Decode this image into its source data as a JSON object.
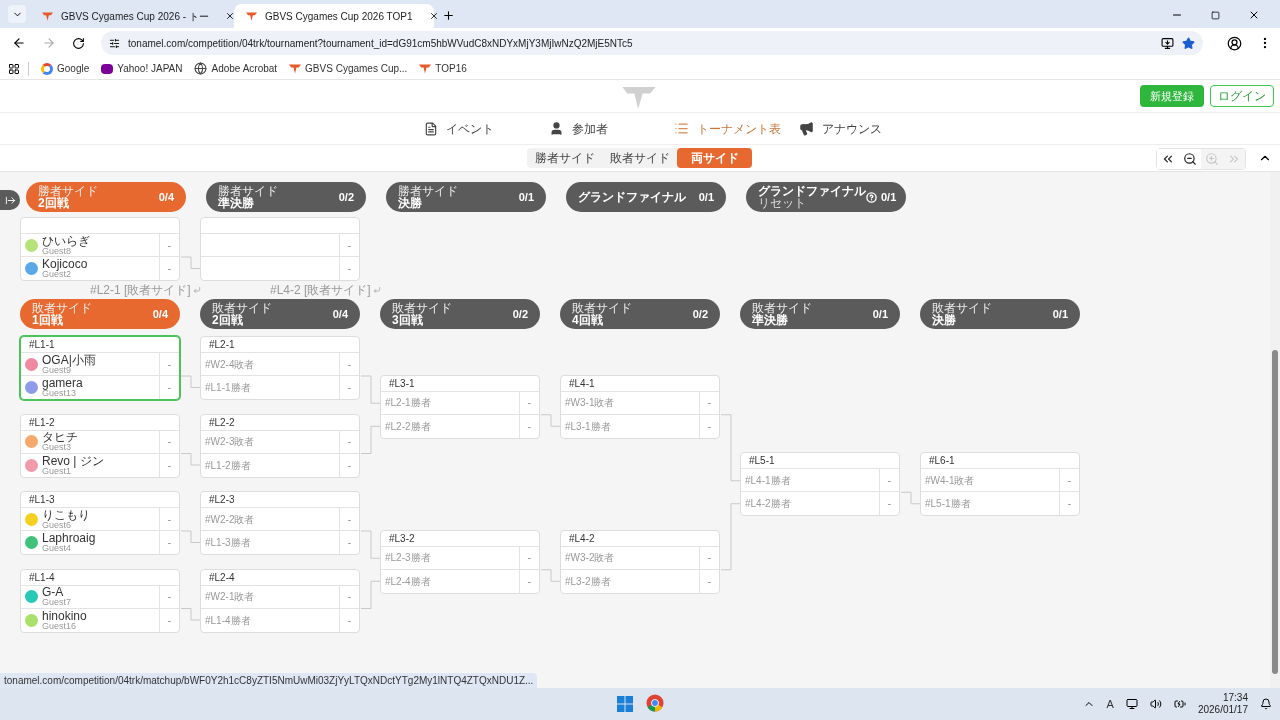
{
  "browser": {
    "tabs": [
      {
        "title": "GBVS Cygames Cup 2026 - トー",
        "selected": false
      },
      {
        "title": "GBVS Cygames Cup 2026 TOP1",
        "selected": true
      }
    ],
    "url": "tonamel.com/competition/04trk/tournament?tournament_id=dG91cm5hbWVudC8xNDYxMjY3MjIwNzQ2MjE5NTc5",
    "bookmarks": [
      {
        "kind": "google",
        "label": "Google"
      },
      {
        "kind": "yahoo",
        "label": "Yahoo! JAPAN"
      },
      {
        "kind": "globe",
        "label": "Adobe Acrobat"
      },
      {
        "kind": "site",
        "label": "GBVS Cygames Cup..."
      },
      {
        "kind": "site",
        "label": "TOP16"
      }
    ]
  },
  "header": {
    "buttons": [
      {
        "kind": "primary",
        "label": "新規登録"
      },
      {
        "kind": "outline",
        "label": "ログイン"
      }
    ]
  },
  "nav": [
    {
      "kind": "event",
      "label": "イベント",
      "selected": false
    },
    {
      "kind": "people",
      "label": "参加者",
      "selected": false
    },
    {
      "kind": "bracket",
      "label": "トーナメント表",
      "selected": true
    },
    {
      "kind": "announce",
      "label": "アナウンス",
      "selected": false
    }
  ],
  "view_tabs": [
    {
      "label": "勝者サイド",
      "selected": false
    },
    {
      "label": "敗者サイド",
      "selected": false
    },
    {
      "label": "両サイド",
      "selected": true
    }
  ],
  "zoom_controls": [
    {
      "kind": "first",
      "disabled": false
    },
    {
      "kind": "zoom_out",
      "disabled": false
    },
    {
      "kind": "zoom_in",
      "disabled": true
    },
    {
      "kind": "last",
      "disabled": true
    }
  ],
  "winners": [
    {
      "side": "勝者サイド",
      "name": "2回戦",
      "progress": "0/4",
      "active": true,
      "matches": [
        {
          "highlighted": false,
          "note": "#L2-1 [敗者サイド]",
          "slots": [
            {
              "kind": "player",
              "name": "ひいらぎ",
              "guest": "Guest8",
              "color": "#b5e37a",
              "score": "-"
            },
            {
              "kind": "player",
              "name": "Kojicoco",
              "guest": "Guest2",
              "color": "#5aa8e8",
              "score": "-"
            }
          ]
        }
      ]
    },
    {
      "side": "勝者サイド",
      "name": "準決勝",
      "progress": "0/2",
      "active": false,
      "matches": [
        {
          "highlighted": false,
          "note": "#L4-2 [敗者サイド]",
          "slots": [
            {
              "kind": "placeholder",
              "score": "-"
            },
            {
              "kind": "placeholder",
              "score": "-"
            }
          ]
        }
      ]
    },
    {
      "side": "勝者サイド",
      "name": "決勝",
      "progress": "0/1",
      "active": false
    },
    {
      "name": "グランドファイナル",
      "progress": "0/1",
      "active": false
    },
    {
      "name": "グランドファイナル",
      "sub": "リセット",
      "help": true,
      "progress": "0/1",
      "active": false
    }
  ],
  "losers": [
    {
      "side": "敗者サイド",
      "name": "1回戦",
      "progress": "0/4",
      "active": true,
      "matches": [
        {
          "id": "#L1-1",
          "highlighted": true,
          "slots": [
            {
              "kind": "player",
              "name": "OGA|小雨",
              "guest": "Guest9",
              "color": "#f08aa0",
              "score": "-"
            },
            {
              "kind": "player",
              "name": "gamera",
              "guest": "Guest13",
              "color": "#8f9bea",
              "score": "-"
            }
          ]
        },
        {
          "id": "#L1-2",
          "highlighted": false,
          "slots": [
            {
              "kind": "player",
              "name": "タヒチ",
              "guest": "Guest3",
              "color": "#f5a96a",
              "score": "-"
            },
            {
              "kind": "player",
              "name": "Revo | ジン",
              "guest": "Guest1",
              "color": "#f19aaa",
              "score": "-"
            }
          ]
        },
        {
          "id": "#L1-3",
          "highlighted": false,
          "slots": [
            {
              "kind": "player",
              "name": "りこもり",
              "guest": "Guest6",
              "color": "#f5d020",
              "score": "-"
            },
            {
              "kind": "player",
              "name": "Laphroaig",
              "guest": "Guest4",
              "color": "#3fc27a",
              "score": "-"
            }
          ]
        },
        {
          "id": "#L1-4",
          "highlighted": false,
          "slots": [
            {
              "kind": "player",
              "name": "G-A",
              "guest": "Guest7",
              "color": "#25c9b8",
              "score": "-"
            },
            {
              "kind": "player",
              "name": "hinokino",
              "guest": "Guest16",
              "color": "#a8e06a",
              "score": "-"
            }
          ]
        }
      ]
    },
    {
      "side": "敗者サイド",
      "name": "2回戦",
      "progress": "0/4",
      "active": false,
      "matches": [
        {
          "id": "#L2-1",
          "highlighted": false,
          "slots": [
            {
              "kind": "placeholder",
              "label": "#W2-4敗者",
              "score": "-"
            },
            {
              "kind": "placeholder",
              "label": "#L1-1勝者",
              "score": "-"
            }
          ]
        },
        {
          "id": "#L2-2",
          "highlighted": false,
          "slots": [
            {
              "kind": "placeholder",
              "label": "#W2-3敗者",
              "score": "-"
            },
            {
              "kind": "placeholder",
              "label": "#L1-2勝者",
              "score": "-"
            }
          ]
        },
        {
          "id": "#L2-3",
          "highlighted": false,
          "slots": [
            {
              "kind": "placeholder",
              "label": "#W2-2敗者",
              "score": "-"
            },
            {
              "kind": "placeholder",
              "label": "#L1-3勝者",
              "score": "-"
            }
          ]
        },
        {
          "id": "#L2-4",
          "highlighted": false,
          "slots": [
            {
              "kind": "placeholder",
              "label": "#W2-1敗者",
              "score": "-"
            },
            {
              "kind": "placeholder",
              "label": "#L1-4勝者",
              "score": "-"
            }
          ]
        }
      ]
    },
    {
      "side": "敗者サイド",
      "name": "3回戦",
      "progress": "0/2",
      "active": false,
      "matches": [
        {
          "id": "#L3-1",
          "highlighted": false,
          "slots": [
            {
              "kind": "placeholder",
              "label": "#L2-1勝者",
              "score": "-"
            },
            {
              "kind": "placeholder",
              "label": "#L2-2勝者",
              "score": "-"
            }
          ]
        },
        {
          "id": "#L3-2",
          "highlighted": false,
          "slots": [
            {
              "kind": "placeholder",
              "label": "#L2-3勝者",
              "score": "-"
            },
            {
              "kind": "placeholder",
              "label": "#L2-4勝者",
              "score": "-"
            }
          ]
        }
      ]
    },
    {
      "side": "敗者サイド",
      "name": "4回戦",
      "progress": "0/2",
      "active": false,
      "matches": [
        {
          "id": "#L4-1",
          "highlighted": false,
          "slots": [
            {
              "kind": "placeholder",
              "label": "#W3-1敗者",
              "score": "-"
            },
            {
              "kind": "placeholder",
              "label": "#L3-1勝者",
              "score": "-"
            }
          ]
        },
        {
          "id": "#L4-2",
          "highlighted": false,
          "slots": [
            {
              "kind": "placeholder",
              "label": "#W3-2敗者",
              "score": "-"
            },
            {
              "kind": "placeholder",
              "label": "#L3-2勝者",
              "score": "-"
            }
          ]
        }
      ]
    },
    {
      "side": "敗者サイド",
      "name": "準決勝",
      "progress": "0/1",
      "active": false,
      "matches": [
        {
          "id": "#L5-1",
          "highlighted": false,
          "slots": [
            {
              "kind": "placeholder",
              "label": "#L4-1勝者",
              "score": "-"
            },
            {
              "kind": "placeholder",
              "label": "#L4-2勝者",
              "score": "-"
            }
          ]
        }
      ]
    },
    {
      "side": "敗者サイド",
      "name": "決勝",
      "progress": "0/1",
      "active": false,
      "matches": [
        {
          "id": "#L6-1",
          "highlighted": false,
          "slots": [
            {
              "kind": "placeholder",
              "label": "#W4-1敗者",
              "score": "-"
            },
            {
              "kind": "placeholder",
              "label": "#L5-1勝者",
              "score": "-"
            }
          ]
        }
      ]
    }
  ],
  "status_url": "tonamel.com/competition/04trk/matchup/bWF0Y2h1cC8yZTI5NmUwMi03ZjYyLTQxNDctYTg2My1lNTQ4ZTQxNDU1Z...",
  "taskbar": {
    "ime": "A",
    "time": "17:34",
    "date": "2026/01/17"
  }
}
